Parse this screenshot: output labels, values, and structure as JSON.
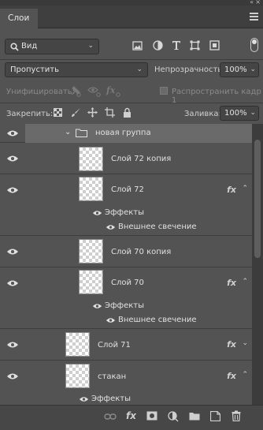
{
  "window": {
    "collapse_glyph": "«",
    "close_glyph": "×"
  },
  "tabs": [
    {
      "label": "Слои"
    }
  ],
  "filter": {
    "kind_label": "Вид",
    "icons": [
      "image-filter-icon",
      "adjustment-filter-icon",
      "type-filter-icon",
      "shape-filter-icon",
      "smart-object-filter-icon"
    ]
  },
  "blend": {
    "mode": "Пропустить",
    "opacity_label": "Непрозрачность:",
    "opacity_value": "100%"
  },
  "unify": {
    "label": "Унифицировать:",
    "propagate_label": "Распространить кадр 1"
  },
  "lock": {
    "label": "Закрепить:",
    "fill_label": "Заливка:",
    "fill_value": "100%"
  },
  "layers": {
    "group_name": "новая группа",
    "items": [
      {
        "name": "Слой 72 копия"
      },
      {
        "name": "Слой 72",
        "effects_label": "Эффекты",
        "effect_name": "Внешнее свечение"
      },
      {
        "name": "Слой 70 копия"
      },
      {
        "name": "Слой 70",
        "effects_label": "Эффекты",
        "effect_name": "Внешнее свечение"
      },
      {
        "name": "Слой 71"
      },
      {
        "name": "стакан",
        "effects_label": "Эффекты"
      }
    ],
    "fx_glyph": "fx"
  },
  "bottom": {
    "fx_glyph": "fx"
  },
  "colors": {
    "panel": "#535353",
    "dark": "#3f3f3f",
    "text": "#d6d6d6"
  }
}
